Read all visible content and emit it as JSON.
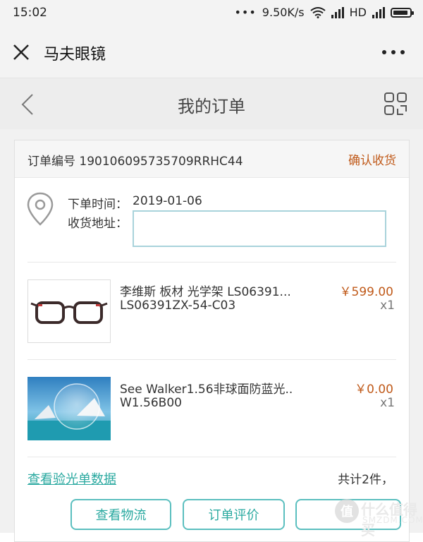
{
  "status_bar": {
    "time": "15:02",
    "net_speed": "9.50K/s",
    "network": "HD"
  },
  "app_bar": {
    "title": "马夫眼镜",
    "close_icon": "close-icon",
    "more_icon": "more-dots-icon"
  },
  "page_header": {
    "title": "我的订单",
    "back_icon": "chevron-left-icon",
    "grid_icon": "grid-icon"
  },
  "order": {
    "number_label": "订单编号 190106095735709RRHC44",
    "status_action": "确认收货",
    "order_time_label": "下单时间：",
    "order_time": "2019-01-06",
    "address_label": "收货地址：",
    "address_value": ""
  },
  "items": [
    {
      "name": "李维斯 板材 光学架 LS06391...",
      "sku": "LS06391ZX-54-C03",
      "price": "￥599.00",
      "qty": "x1"
    },
    {
      "name": "See Walker1.56非球面防蓝光..",
      "sku": "W1.56B00",
      "price": "￥0.00",
      "qty": "x1"
    }
  ],
  "footer": {
    "prescription_link": "查看验光单数据",
    "total": "共计2件，"
  },
  "actions": {
    "logistics": "查看物流",
    "review": "订单评价",
    "third": ""
  },
  "watermark": {
    "line1": "值 什么值得买",
    "line2": "SMZDM.COM"
  },
  "colors": {
    "accent": "#2aa9a0",
    "price": "#c05a1a",
    "address_border": "#a9d3db"
  }
}
